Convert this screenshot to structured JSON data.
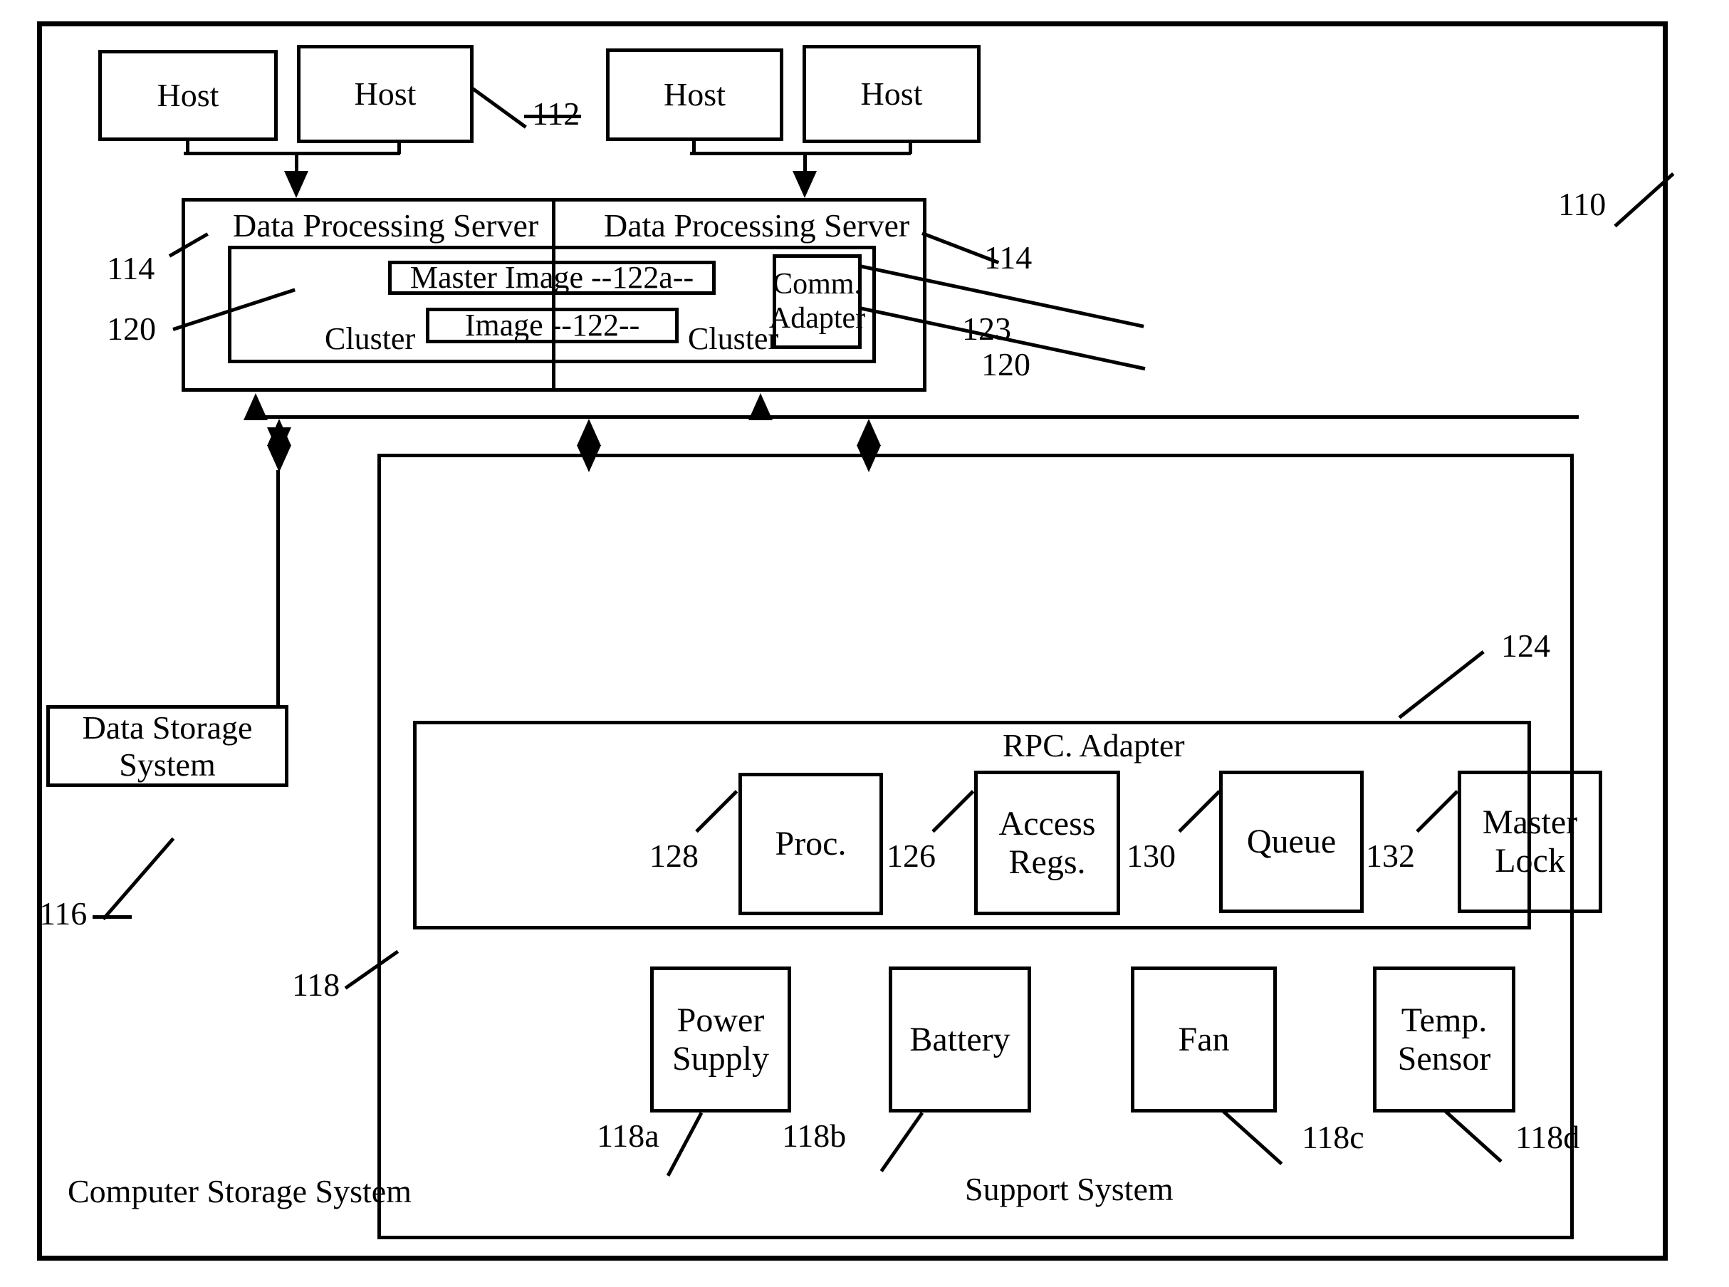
{
  "figure": {
    "type": "patent-block-diagram",
    "outer_system_label": "Computer Storage System",
    "outer_ref": "110"
  },
  "hosts": [
    {
      "label": "Host"
    },
    {
      "label": "Host"
    },
    {
      "label": "Host"
    },
    {
      "label": "Host"
    }
  ],
  "host_ref": "112",
  "servers": [
    {
      "label": "Data Processing Server"
    },
    {
      "label": "Data Processing Server"
    }
  ],
  "server_refs": {
    "left": "114",
    "right": "114"
  },
  "cluster": {
    "left_label": "Cluster",
    "right_label": "Cluster",
    "ref_left": "120",
    "ref_right": "120"
  },
  "images": {
    "master": "Master Image   --122a--",
    "image": "Image   --122--"
  },
  "comm_adapter": {
    "line1": "Comm.",
    "line2": "Adapter",
    "ref": "123"
  },
  "data_storage": {
    "label": "Data Storage System",
    "ref": "116"
  },
  "support_system": {
    "label": "Support System",
    "ref": "118",
    "rpc_adapter": {
      "label": "RPC. Adapter",
      "ref": "124",
      "components": [
        {
          "label": "Proc.",
          "ref": "128"
        },
        {
          "label": "Access\nRegs.",
          "ref": "126"
        },
        {
          "label": "Queue",
          "ref": "130"
        },
        {
          "label": "Master\nLock",
          "ref": "132"
        }
      ]
    },
    "devices": [
      {
        "label": "Power\nSupply",
        "ref": "118a"
      },
      {
        "label": "Battery",
        "ref": "118b"
      },
      {
        "label": "Fan",
        "ref": "118c"
      },
      {
        "label": "Temp.\nSensor",
        "ref": "118d"
      }
    ]
  },
  "colors": {
    "ink": "#000000",
    "paper": "#ffffff"
  }
}
